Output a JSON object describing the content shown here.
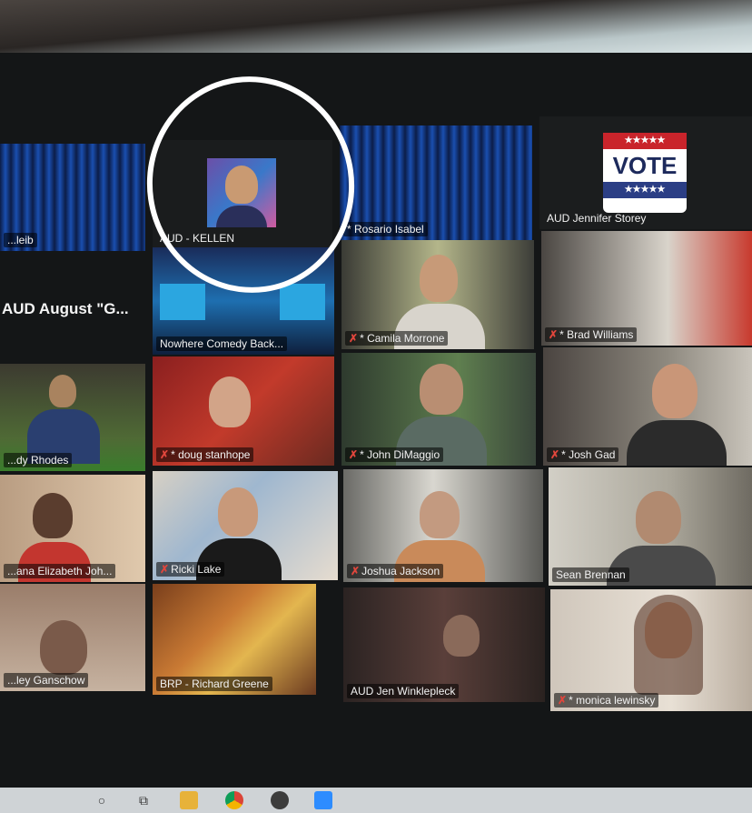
{
  "participants": [
    {
      "name": "...leib",
      "muted": false
    },
    {
      "name": "AUD - KELLEN",
      "muted": false
    },
    {
      "name": "* Rosario Isabel",
      "muted": false
    },
    {
      "name": "AUD Jennifer Storey",
      "muted": false
    },
    {
      "name": "AUD August \"G...",
      "muted": false
    },
    {
      "name": "Nowhere Comedy Back...",
      "muted": false
    },
    {
      "name": "* Camila Morrone",
      "muted": true
    },
    {
      "name": "* Brad Williams",
      "muted": true
    },
    {
      "name": "...dy Rhodes",
      "muted": false
    },
    {
      "name": "* doug stanhope",
      "muted": true
    },
    {
      "name": "* John DiMaggio",
      "muted": true
    },
    {
      "name": "* Josh Gad",
      "muted": true
    },
    {
      "name": "...ana Elizabeth Joh...",
      "muted": false
    },
    {
      "name": "Ricki Lake",
      "muted": true
    },
    {
      "name": "Joshua Jackson",
      "muted": true
    },
    {
      "name": "Sean Brennan",
      "muted": false
    },
    {
      "name": "...ley Ganschow",
      "muted": false
    },
    {
      "name": "BRP - Richard Greene",
      "muted": false
    },
    {
      "name": "AUD Jen Winklepleck",
      "muted": false
    },
    {
      "name": "* monica lewinsky",
      "muted": true
    }
  ],
  "vote_sign": {
    "stars": "★★★★★",
    "word": "VOTE"
  },
  "muted_glyph": "✗",
  "taskbar_icons": [
    "search-circle-icon",
    "task-view-icon",
    "file-explorer-icon",
    "chrome-icon",
    "app-icon",
    "zoom-icon"
  ],
  "colors": {
    "screen": "#141617",
    "muted": "#e0463c",
    "highlight_circle": "#ffffff"
  }
}
